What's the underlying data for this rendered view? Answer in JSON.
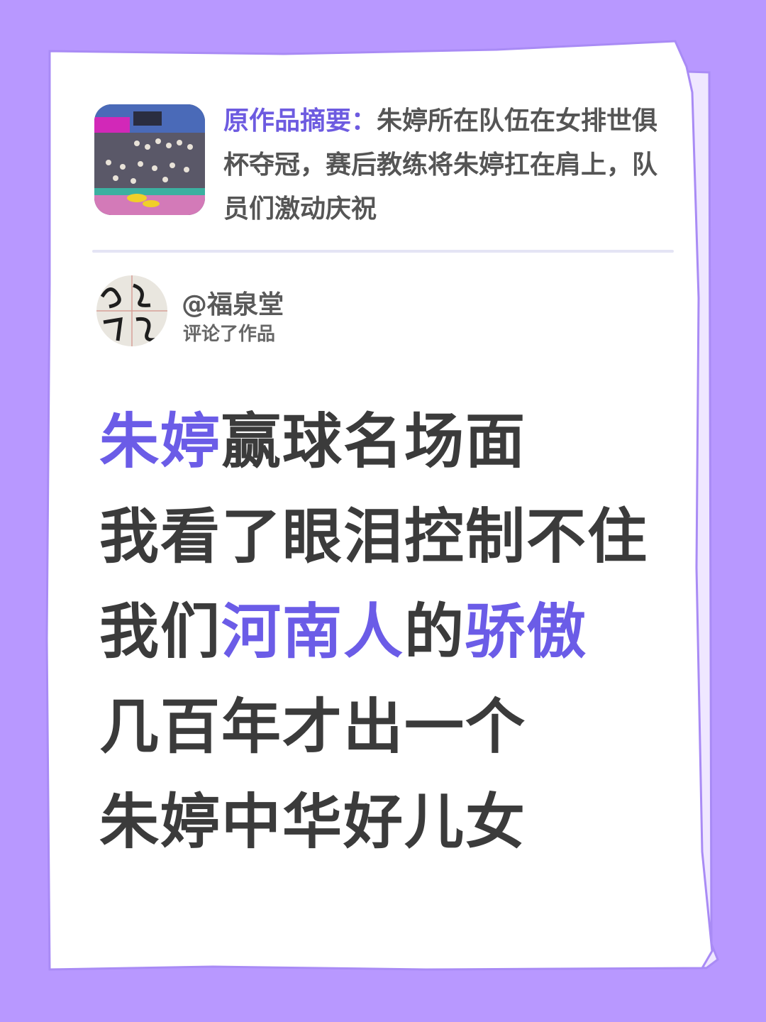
{
  "colors": {
    "background": "#b898ff",
    "card": "#ffffff",
    "card_border": "#a98bf5",
    "accent": "#6b5ce7",
    "body_text": "#3b3b3b"
  },
  "summary": {
    "label": "原作品摘要：",
    "text": "朱婷所在队伍在女排世俱杯夺冠，赛后教练将朱婷扛在肩上，队员们激动庆祝",
    "thumbnail": "volleyball-arena-photo"
  },
  "commenter": {
    "name": "@福泉堂",
    "action": "评论了作品",
    "avatar": "calligraphy-avatar"
  },
  "comment": {
    "line1_hl": "朱婷",
    "line1_rest": "赢球名场面",
    "line2": "我看了眼泪控制不住",
    "line3_a": "我们",
    "line3_hl1": "河南人",
    "line3_b": "的",
    "line3_hl2": "骄傲",
    "line4": "几百年才出一个",
    "line5": "朱婷中华好儿女"
  }
}
